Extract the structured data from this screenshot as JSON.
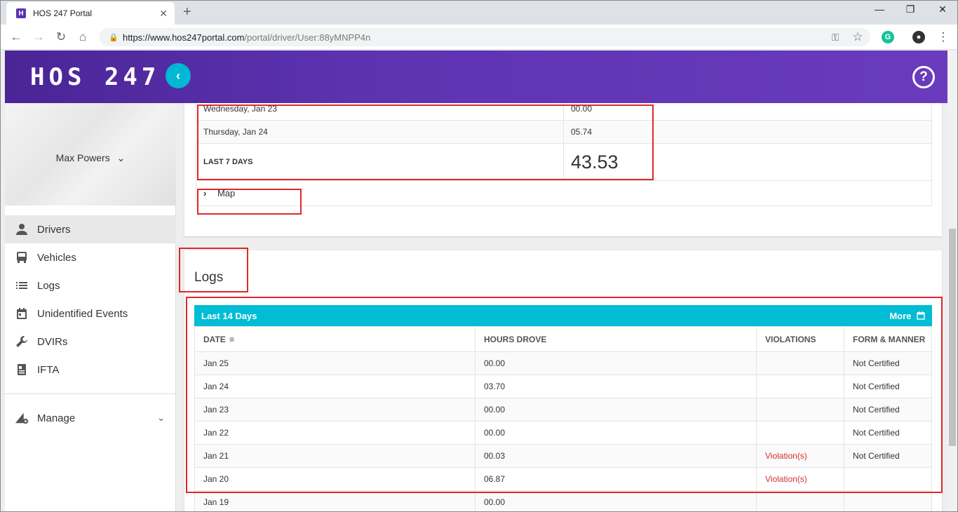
{
  "browser": {
    "tab_title": "HOS 247 Portal",
    "tab_favicon": "H",
    "url_host": "https://www.hos247portal.com",
    "url_path": "/portal/driver/User:88yMNPP4n"
  },
  "header": {
    "logo": "HOS 247"
  },
  "sidebar": {
    "profile_name": "Max Powers",
    "items": [
      {
        "label": "Drivers",
        "icon": "person-icon"
      },
      {
        "label": "Vehicles",
        "icon": "bus-icon"
      },
      {
        "label": "Logs",
        "icon": "list-icon"
      },
      {
        "label": "Unidentified Events",
        "icon": "calendar-icon"
      },
      {
        "label": "DVIRs",
        "icon": "wrench-icon"
      },
      {
        "label": "IFTA",
        "icon": "document-icon"
      }
    ],
    "manage_label": "Manage"
  },
  "summary": {
    "rows": [
      {
        "day": "Wednesday, Jan 23",
        "hours": "00.00"
      },
      {
        "day": "Thursday, Jan 24",
        "hours": "05.74"
      }
    ],
    "total_label": "LAST 7 DAYS",
    "total_value": "43.53",
    "map_label": "Map"
  },
  "logs": {
    "title": "Logs",
    "bar_title": "Last 14 Days",
    "more_label": "More",
    "columns": [
      "DATE",
      "HOURS DROVE",
      "VIOLATIONS",
      "FORM & MANNER"
    ],
    "rows": [
      {
        "date": "Jan 25",
        "hours": "00.00",
        "violations": "",
        "form": "Not Certified"
      },
      {
        "date": "Jan 24",
        "hours": "03.70",
        "violations": "",
        "form": "Not Certified"
      },
      {
        "date": "Jan 23",
        "hours": "00.00",
        "violations": "",
        "form": "Not Certified"
      },
      {
        "date": "Jan 22",
        "hours": "00.00",
        "violations": "",
        "form": "Not Certified"
      },
      {
        "date": "Jan 21",
        "hours": "00.03",
        "violations": "Violation(s)",
        "form": "Not Certified"
      },
      {
        "date": "Jan 20",
        "hours": "06.87",
        "violations": "Violation(s)",
        "form": ""
      },
      {
        "date": "Jan 19",
        "hours": "00.00",
        "violations": "",
        "form": ""
      }
    ]
  },
  "colors": {
    "header": "#5e33b2",
    "accent": "#00bcd4",
    "annotation": "#e0262b",
    "violation": "#d32f2f"
  }
}
